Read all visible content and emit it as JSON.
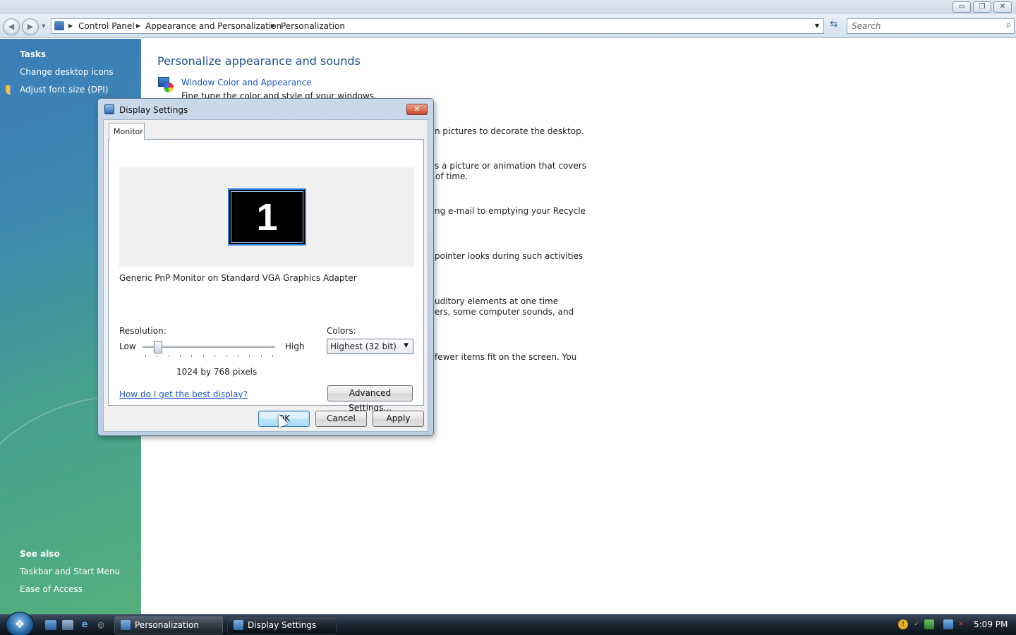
{
  "window": {
    "controls": {
      "minimize": "▭",
      "restore": "❐",
      "close": "✕"
    }
  },
  "nav": {
    "back_icon": "◀",
    "forward_icon": "▶",
    "breadcrumbs": [
      "Control Panel",
      "Appearance and Personalization",
      "Personalization"
    ],
    "search_placeholder": "Search"
  },
  "sidebar": {
    "tasks_heading": "Tasks",
    "tasks": [
      "Change desktop icons",
      "Adjust font size (DPI)"
    ],
    "see_also_heading": "See also",
    "see_also": [
      "Taskbar and Start Menu",
      "Ease of Access"
    ]
  },
  "content": {
    "title": "Personalize appearance and sounds",
    "first_item": {
      "link": "Window Color and Appearance",
      "desc": "Fine tune the color and style of your windows."
    },
    "visible_desc_fragments": [
      "n pictures to decorate the desktop.",
      "s a picture or animation that covers",
      "of time.",
      "ng e-mail to emptying your Recycle",
      "pointer looks during such activities",
      "uditory elements at one time",
      "ers, some computer sounds, and",
      "fewer items fit on the screen. You"
    ]
  },
  "dialog": {
    "title": "Display Settings",
    "close": "✕",
    "tab": "Monitor",
    "monitor_number": "1",
    "monitor_name": "Generic PnP Monitor on Standard VGA Graphics Adapter",
    "resolution_label": "Resolution:",
    "low": "Low",
    "high": "High",
    "resolution_value": "1024 by 768 pixels",
    "resolution_slider_fraction": 0.1,
    "colors_label": "Colors:",
    "colors_value": "Highest (32 bit)",
    "help_link": "How do I get the best display?",
    "advanced_button": "Advanced Settings...",
    "ok_button": "OK",
    "cancel_button": "Cancel",
    "apply_button": "Apply"
  },
  "taskbar": {
    "start_icon": "start-orb-icon",
    "tasks": [
      "Personalization",
      "Display Settings"
    ],
    "clock": "5:09 PM"
  },
  "colors": {
    "link_blue": "#1a56c4",
    "title_blue": "#1f4f92",
    "monitor_highlight": "#2f7ee0"
  }
}
